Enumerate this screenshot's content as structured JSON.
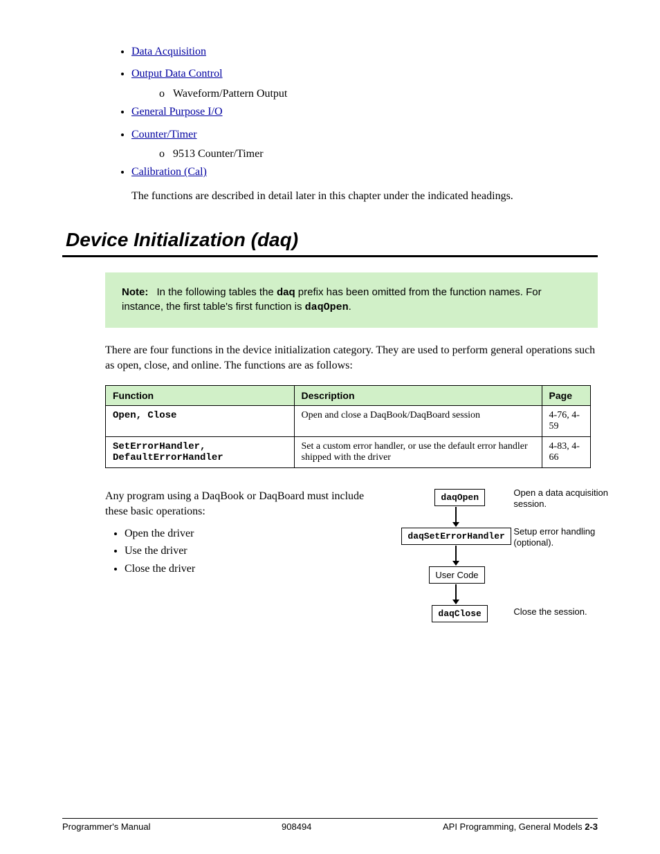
{
  "toc": {
    "items": [
      {
        "label": "Data Acquisition",
        "sub": null
      },
      {
        "label": "Output Data Control",
        "sub": null
      },
      {
        "label": "o",
        "is_spacer": true,
        "plain": "Waveform/Pattern Output"
      },
      {
        "label": "General Purpose I/O",
        "sub": null
      },
      {
        "label": "Counter/Timer",
        "sub": null
      },
      {
        "label": "o",
        "is_spacer": true,
        "plain": "9513 Counter/Timer"
      },
      {
        "label": "Calibration (Cal)",
        "sub": null
      }
    ],
    "paragraph": "The functions are described in detail later in this chapter under the indicated headings."
  },
  "section_title": "Device Initialization (daq)",
  "note": {
    "title": "Note:",
    "body_pre": "In the following tables the ",
    "body_bold": "daq",
    "body_post": " prefix has been omitted from the function names. For instance, the first table's first function is "
  },
  "note_mono": "daqOpen",
  "body_para": "There are four functions in the device initialization category.  They are used to perform general operations such as open, close, and online.  The functions are as follows:",
  "table": {
    "headers": [
      "Function",
      "Description",
      "Page"
    ],
    "rows": [
      {
        "fn": "Open, Close",
        "desc": "Open and close a DaqBook/DaqBoard session",
        "page": "4-76, 4-59"
      },
      {
        "fn": "SetErrorHandler, DefaultErrorHandler",
        "desc": "Set a custom error handler, or use the default error handler shipped with the driver",
        "page": "4-83, 4-66"
      }
    ]
  },
  "init_para": "Any program using a DaqBook or DaqBoard must include these basic operations:",
  "init_bullets": [
    "Open the driver",
    "Use the driver",
    "Close the driver"
  ],
  "diagram": {
    "b1": "daqOpen",
    "l1": "Open a data acquisition session.",
    "b2": "daqSetErrorHandler",
    "l2": "Setup error handling (optional).",
    "b3": "User Code",
    "b4": "daqClose",
    "l4": "Close the session."
  },
  "footer": {
    "left": "Programmer's Manual",
    "center": "908494",
    "right_pre": "API Programming, General Models     ",
    "right_bold": "2-3"
  }
}
